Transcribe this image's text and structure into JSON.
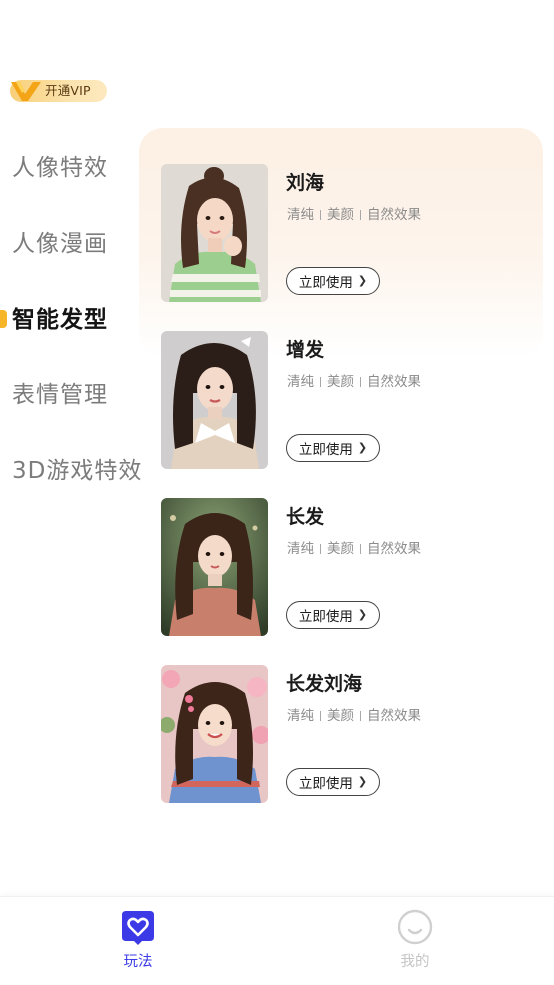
{
  "vip": {
    "label": "开通VIP"
  },
  "categories": [
    {
      "label": "人像特效",
      "active": false
    },
    {
      "label": "人像漫画",
      "active": false
    },
    {
      "label": "智能发型",
      "active": true
    },
    {
      "label": "表情管理",
      "active": false
    },
    {
      "label": "3D游戏特效",
      "active": false
    }
  ],
  "styles": [
    {
      "title": "刘海",
      "tags": [
        "清纯",
        "美颜",
        "自然效果"
      ],
      "button": "立即使用"
    },
    {
      "title": "增发",
      "tags": [
        "清纯",
        "美颜",
        "自然效果"
      ],
      "button": "立即使用"
    },
    {
      "title": "长发",
      "tags": [
        "清纯",
        "美颜",
        "自然效果"
      ],
      "button": "立即使用"
    },
    {
      "title": "长发刘海",
      "tags": [
        "清纯",
        "美颜",
        "自然效果"
      ],
      "button": "立即使用"
    }
  ],
  "tabbar": {
    "tabs": [
      {
        "label": "玩法",
        "icon": "heart-chat-icon",
        "active": true
      },
      {
        "label": "我的",
        "icon": "smile-face-icon",
        "active": false
      }
    ]
  },
  "colors": {
    "accent": "#3b3ae6",
    "active_bar": "#f7b52a",
    "vip_gold": "#f8cf79"
  }
}
